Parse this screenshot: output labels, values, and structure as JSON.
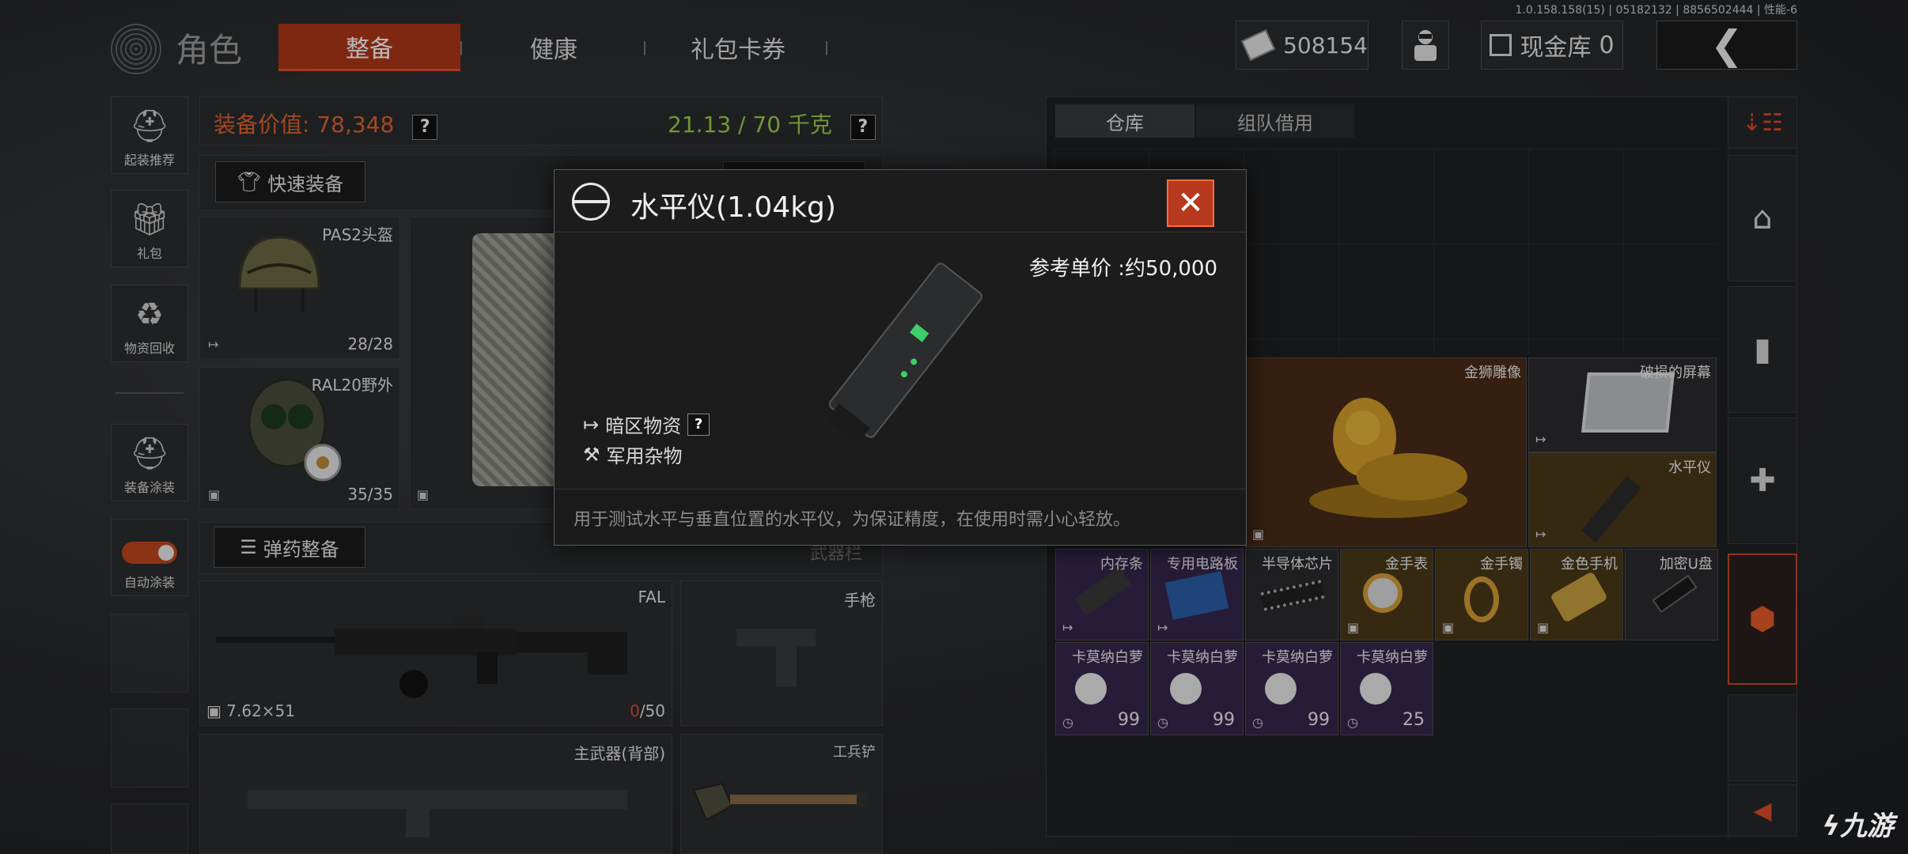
{
  "version": "1.0.158.158(15) | 05182132 | 8856502444 | 性能-6",
  "header": {
    "title": "角色",
    "tabs": [
      "整备",
      "健康",
      "礼包卡券"
    ],
    "money": "508154",
    "cash_label": "现金库",
    "cash_count": "0",
    "back": "❮"
  },
  "sidebar": [
    {
      "label": "起装推荐",
      "icon": "helmet-icon"
    },
    {
      "label": "礼包",
      "icon": "gift-icon"
    },
    {
      "label": "物资回收",
      "icon": "recycle-icon"
    },
    {
      "label": "装备涂装",
      "icon": "paint-icon"
    },
    {
      "label": "自动涂装",
      "icon": "toggle-icon"
    }
  ],
  "equipment": {
    "value_label": "装备价值:",
    "value": "78,348",
    "weight": "21.13 / 70 千克",
    "quick_equip": "快速装备",
    "ammo_equip": "弹药整备",
    "weapon_bar": "武器栏",
    "slots": [
      {
        "name": "PAS2头盔",
        "count": "28/28"
      },
      {
        "name": "RAL20野外",
        "count": "35/35"
      }
    ],
    "primary": {
      "name": "FAL",
      "caliber": "7.62×51",
      "ammo_loaded": "0",
      "ammo_total": "/50"
    },
    "pistol": "手枪",
    "back_weapon": "主武器(背部)",
    "shovel": "工兵铲"
  },
  "storage": {
    "tabs": [
      "仓库",
      "组队借用"
    ],
    "big_items": [
      {
        "name": "金狮雕像"
      },
      {
        "name": "破损的屏幕"
      },
      {
        "name": "水平仪"
      }
    ],
    "row1": [
      {
        "name": "内存条"
      },
      {
        "name": "专用电路板"
      },
      {
        "name": "半导体芯片"
      },
      {
        "name": "金手表"
      },
      {
        "name": "金手镯"
      },
      {
        "name": "金色手机"
      },
      {
        "name": "加密U盘"
      }
    ],
    "row2": [
      {
        "name": "卡莫纳白萝",
        "count": "99"
      },
      {
        "name": "卡莫纳白萝",
        "count": "99"
      },
      {
        "name": "卡莫纳白萝",
        "count": "99"
      },
      {
        "name": "卡莫纳白萝",
        "count": "25"
      }
    ]
  },
  "popup": {
    "title": "水平仪(1.04kg)",
    "close": "✕",
    "price": "参考单价 :约50,000",
    "tag1": "暗区物资",
    "tag2": "军用杂物",
    "question": "?",
    "description": "用于测试水平与垂直位置的水平仪，为保证精度，在使用时需小心轻放。"
  },
  "watermark": "九游",
  "colors": {
    "accent": "#b2361a",
    "value_orange": "#e06633",
    "weight_green": "#9cd14a",
    "gold_bg": "#6a4a14",
    "purple_bg": "#3a2a5a"
  }
}
